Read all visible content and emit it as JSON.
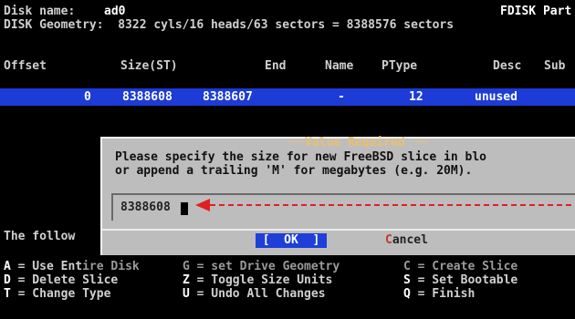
{
  "header": {
    "disk_name_label": "Disk name:",
    "disk_name_value": "ad0",
    "program_title": "FDISK Part",
    "geometry_text": "DISK Geometry:  8322 cyls/16 heads/63 sectors = 8388576 sectors"
  },
  "table": {
    "columns": [
      "Offset",
      "Size(ST)",
      "End",
      "Name",
      "PType",
      "Desc",
      "Sub"
    ],
    "rows": [
      {
        "offset": "0",
        "size": "8388608",
        "end": "8388607",
        "name": "-",
        "ptype": "12",
        "desc": "unused"
      }
    ]
  },
  "dialog": {
    "title": "Value Required",
    "line1": "Please specify the size for new FreeBSD slice in blo",
    "line2": "or append a trailing 'M' for megabytes (e.g. 20M).",
    "input_value": "8388608",
    "ok_label": "[  OK  ]",
    "cancel_hotkey": "C",
    "cancel_rest": "ancel"
  },
  "partial_text": "The follow",
  "commands": [
    {
      "key": "A",
      "text": " = Use Ent",
      "dim_text": "ire Disk",
      "key2": "G",
      "text2": " = set Drive Geometry",
      "key3": "C",
      "text3": " = Create Slice",
      "dim2": true
    },
    {
      "key": "D",
      "text": " = Delete Slice",
      "key2": "Z",
      "text2": " = Toggle Size Units",
      "key3": "S",
      "text3": " = Set Bootable"
    },
    {
      "key": "T",
      "text": " = Change Type",
      "key2": "U",
      "text2": " = Undo All Changes",
      "key3": "Q",
      "text3": " = Finish"
    }
  ],
  "colors": {
    "highlight": "#1d3bd6",
    "annotation_arrow": "#e02020"
  }
}
